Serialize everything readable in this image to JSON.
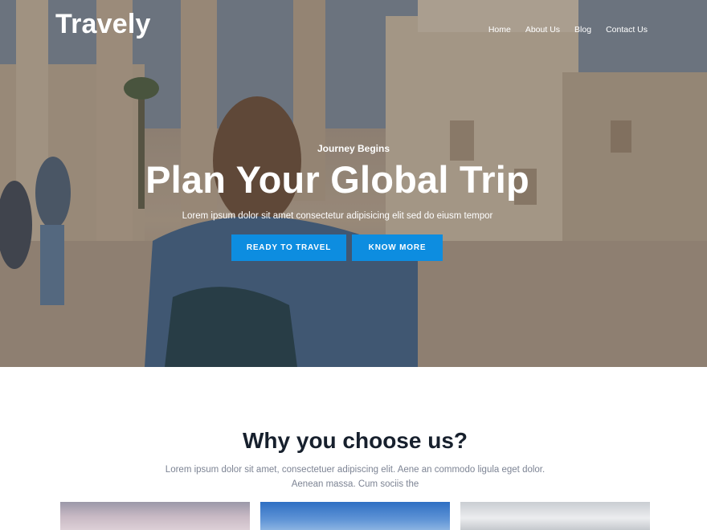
{
  "header": {
    "brand": "Travely",
    "nav": [
      "Home",
      "About Us",
      "Blog",
      "Contact Us"
    ]
  },
  "hero": {
    "kicker": "Journey Begins",
    "title": "Plan Your Global Trip",
    "subtitle": "Lorem ipsum dolor sit amet consectetur adipisicing elit sed do eiusm tempor",
    "buttons": {
      "primary": "READY TO TRAVEL",
      "secondary": "KNOW MORE"
    }
  },
  "why": {
    "title": "Why you choose us?",
    "text": "Lorem ipsum dolor sit amet, consectetuer adipiscing elit. Aene an commodo ligula eget dolor. Aenean massa. Cum sociis the"
  },
  "colors": {
    "accent": "#0d8de0",
    "heading": "#17202d",
    "muted": "#7d8494"
  }
}
